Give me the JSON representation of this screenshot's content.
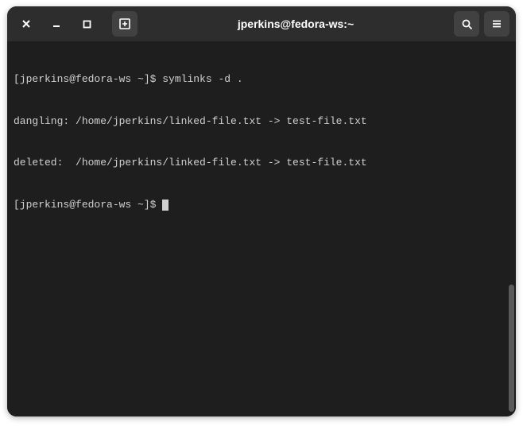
{
  "window": {
    "title": "jperkins@fedora-ws:~"
  },
  "terminal": {
    "lines": [
      {
        "prompt": "[jperkins@fedora-ws ~]$ ",
        "text": "symlinks -d ."
      },
      {
        "prompt": "",
        "text": "dangling: /home/jperkins/linked-file.txt -> test-file.txt"
      },
      {
        "prompt": "",
        "text": "deleted:  /home/jperkins/linked-file.txt -> test-file.txt"
      },
      {
        "prompt": "[jperkins@fedora-ws ~]$ ",
        "text": ""
      }
    ]
  }
}
